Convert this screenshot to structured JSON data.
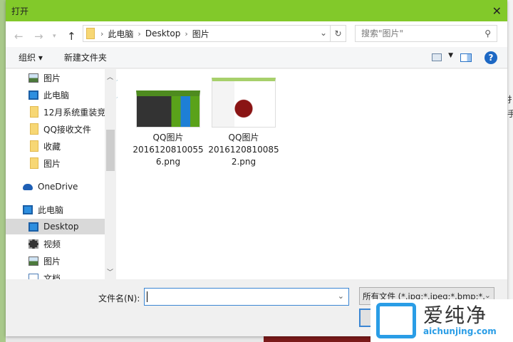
{
  "title": "打开",
  "address": {
    "crumbs": [
      "此电脑",
      "Desktop",
      "图片"
    ],
    "search_placeholder": "搜索\"图片\""
  },
  "toolbar": {
    "organize": "组织 ▾",
    "new_folder": "新建文件夹",
    "help": "?"
  },
  "nav": {
    "quick": [
      {
        "label": "图片",
        "icon": "picture"
      },
      {
        "label": "此电脑",
        "icon": "pc"
      },
      {
        "label": "12月系统重装竞",
        "icon": "folder"
      },
      {
        "label": "QQ接收文件",
        "icon": "folder"
      },
      {
        "label": "收藏",
        "icon": "folder"
      },
      {
        "label": "图片",
        "icon": "folder"
      }
    ],
    "onedrive": "OneDrive",
    "thispc": "此电脑",
    "pc_items": [
      {
        "label": "Desktop",
        "icon": "desktop"
      },
      {
        "label": "视频",
        "icon": "video"
      },
      {
        "label": "图片",
        "icon": "picture"
      },
      {
        "label": "文档",
        "icon": "document"
      }
    ]
  },
  "files": [
    {
      "line1": "QQ图片",
      "line2": "2016120810055",
      "line3": "6.png"
    },
    {
      "line1": "QQ图片",
      "line2": "2016120810085",
      "line3": "2.png"
    }
  ],
  "bottom": {
    "filename_label": "文件名(N):",
    "filename_value": "",
    "filetype": "所有文件 (*.jpg;*.jpeg;*.bmp;*."
  },
  "watermark": {
    "cn": "爱纯净",
    "en": "aichunjing.com"
  },
  "peek": "扌\n手"
}
